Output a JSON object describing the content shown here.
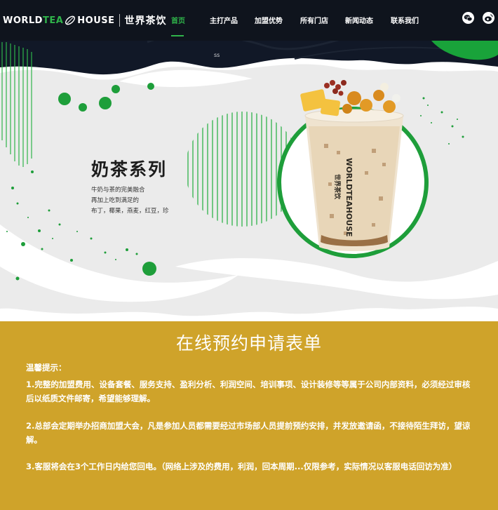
{
  "header": {
    "logo_en_a": "WORLD",
    "logo_en_b": "TEA",
    "logo_en_c": "HOUSE",
    "logo_cn": "世界茶饮",
    "nav": [
      {
        "label": "首页",
        "active": true
      },
      {
        "label": "主打产品",
        "active": false
      },
      {
        "label": "加盟优势",
        "active": false
      },
      {
        "label": "所有门店",
        "active": false
      },
      {
        "label": "新闻动态",
        "active": false
      },
      {
        "label": "联系我们",
        "active": false
      }
    ],
    "social_icons": [
      "wechat-icon",
      "weibo-icon"
    ]
  },
  "hero": {
    "title": "奶茶系列",
    "desc_lines": [
      "牛奶与茶的完美融合",
      "再加上吃到满足的",
      "布丁，椰果，燕麦，红豆，珍"
    ],
    "small_mark": "ss",
    "cup_logo_en": "WORLDTEAHOUSE",
    "cup_logo_cn": "世界茶饮"
  },
  "apply": {
    "title": "在线预约申请表单",
    "tips_label": "温馨提示：",
    "tips": [
      "1.完整的加盟费用、设备套餐、服务支持、盈利分析、利润空间、培训事项、设计装修等等属于公司内部资料，必须经过审核后以纸质文件邮寄，希望能够理解。",
      "2.总部会定期举办招商加盟大会，凡是参加人员都需要经过市场部人员提前预约安排，并发放邀请函，不接待陌生拜访，望谅解。",
      "3.客服将会在3个工作日内给您回电。（网络上涉及的费用，利润，回本周期...仅限参考，实际情况以客服电话回访为准）"
    ]
  },
  "colors": {
    "nav_bg": "#0f141d",
    "accent_green": "#2fb34a",
    "apply_bg": "#cfa32a",
    "hero_grey": "#ebebeb"
  }
}
